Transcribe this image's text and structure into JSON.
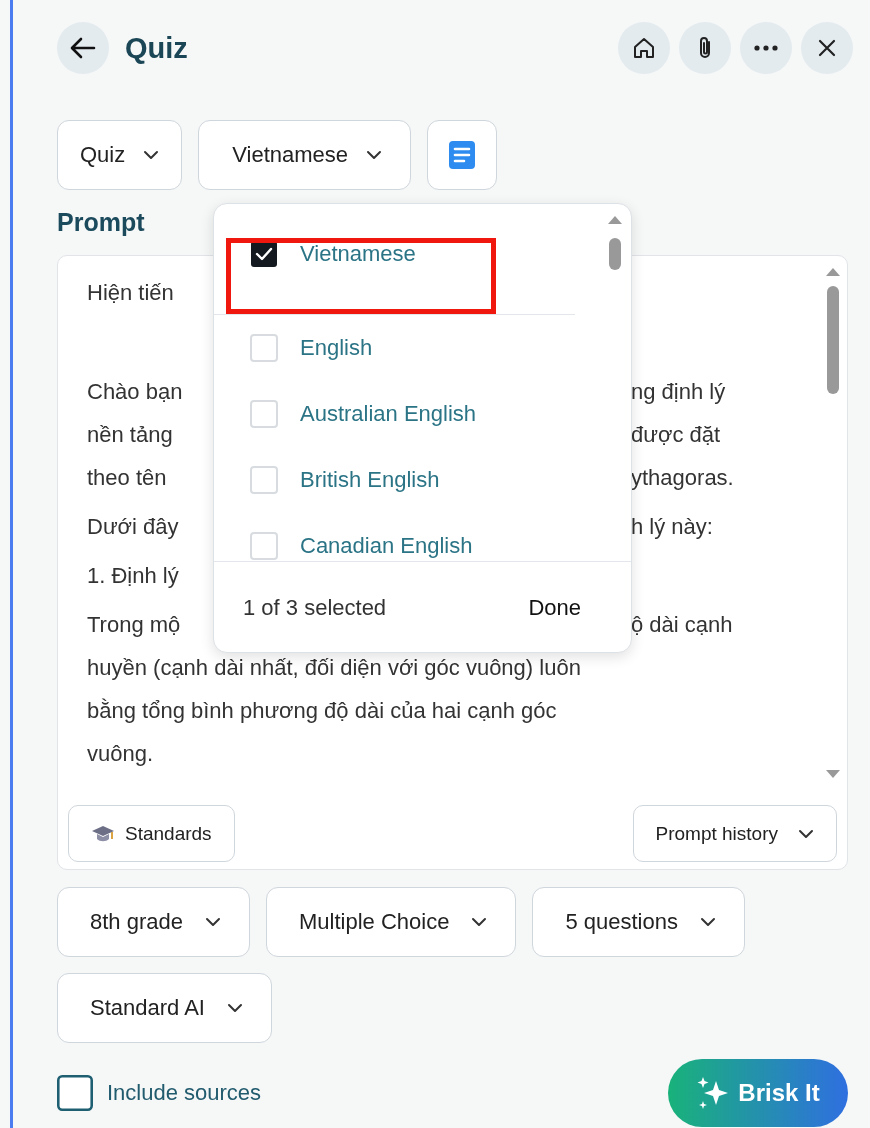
{
  "header": {
    "title": "Quiz"
  },
  "toolbar": {
    "selects": [
      "Quiz",
      "Vietnamese"
    ]
  },
  "language_menu": {
    "pinned": [
      {
        "label": "Vietnamese",
        "checked": true,
        "highlighted": true
      }
    ],
    "options": [
      {
        "label": "English",
        "checked": false,
        "highlighted": false
      },
      {
        "label": "Australian English",
        "checked": false,
        "highlighted": false
      },
      {
        "label": "British English",
        "checked": false,
        "highlighted": false
      },
      {
        "label": "Canadian English",
        "checked": false,
        "highlighted": false
      }
    ],
    "summary": "1 of 3 selected",
    "done": "Done"
  },
  "prompt": {
    "label": "Prompt",
    "paragraphs": [
      {
        "kind": "text",
        "lines": [
          {
            "left": "Hiện tiến"
          }
        ]
      },
      {
        "kind": "blank"
      },
      {
        "kind": "text",
        "lines": [
          {
            "left": "Chào bạn",
            "right": "ng định lý"
          },
          {
            "left": "nền tảng",
            "right": "được đặt"
          },
          {
            "left": "theo tên",
            "right": "ythagoras."
          }
        ]
      },
      {
        "kind": "text",
        "lines": [
          {
            "left": "Dưới đây",
            "right": "h lý này:"
          }
        ]
      },
      {
        "kind": "text",
        "lines": [
          {
            "left": "1. Định lý"
          }
        ]
      },
      {
        "kind": "text",
        "lines": [
          {
            "left": "Trong mộ",
            "right": "ộ dài cạnh"
          },
          {
            "left": "huyền (cạnh dài nhất, đối diện với góc vuông) luôn"
          },
          {
            "left": "bằng tổng bình phương độ dài của hai cạnh góc"
          },
          {
            "left": "vuông."
          }
        ]
      }
    ],
    "standards": "Standards",
    "history": "Prompt history"
  },
  "options": {
    "selects": [
      "8th grade",
      "Multiple Choice",
      "5 questions",
      "Standard AI"
    ],
    "include_sources": {
      "label": "Include sources",
      "checked": false
    },
    "submit": "Brisk It"
  }
}
